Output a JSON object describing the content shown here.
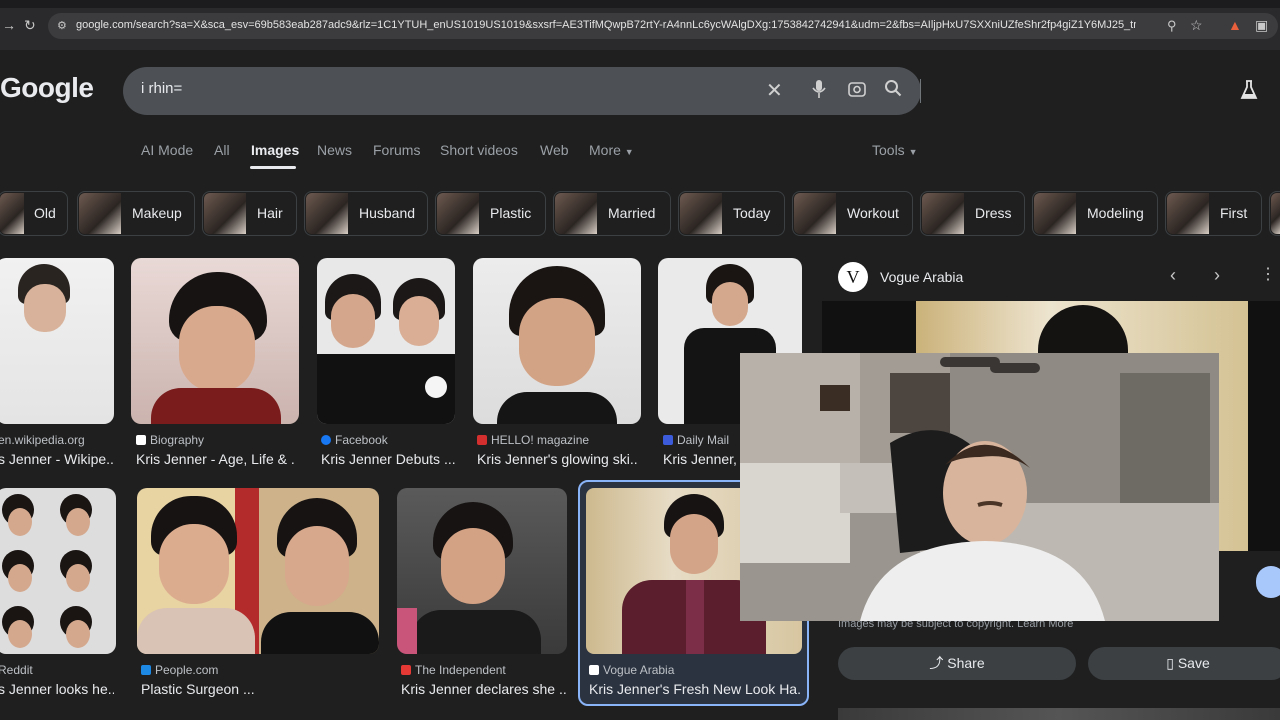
{
  "browser": {
    "url": "google.com/search?sa=X&sca_esv=69b583eab287adc9&rlz=1C1YTUH_enUS1019US1019&sxsrf=AE3TifMQwpB72rtY-rA4nnLc6ycWAlgDXg:1753842742941&udm=2&fbs=AIljpHxU7SXXniUZfeShr2fp4giZ1Y6MJ25_tmWITc7uy4Klei8e83z..."
  },
  "google": {
    "logo": "Google",
    "query": "i rhin="
  },
  "nav": {
    "tabs": [
      "AI Mode",
      "All",
      "Images",
      "News",
      "Forums",
      "Short videos",
      "Web",
      "More"
    ],
    "tools": "Tools"
  },
  "chips": [
    "Old",
    "Makeup",
    "Hair",
    "Husband",
    "Plastic",
    "Married",
    "Today",
    "Workout",
    "Dress",
    "Modeling",
    "First"
  ],
  "results": [
    {
      "source": "en.wikipedia.org",
      "title": "s Jenner - Wikipe..."
    },
    {
      "source": "Biography",
      "title": "Kris Jenner - Age, Life & ..."
    },
    {
      "source": "Facebook",
      "title": "Kris Jenner Debuts ..."
    },
    {
      "source": "HELLO! magazine",
      "title": "Kris Jenner's glowing ski..."
    },
    {
      "source": "Daily Mail",
      "title": "Kris Jenner, 6"
    },
    {
      "source": "Reddit",
      "title": "s Jenner looks he..."
    },
    {
      "source": "People.com",
      "title": "Plastic Surgeon ..."
    },
    {
      "source": "The Independent",
      "title": "Kris Jenner declares she ..."
    },
    {
      "source": "Vogue Arabia",
      "title": "Kris Jenner's Fresh New Look Ha..."
    }
  ],
  "panel": {
    "logo_letter": "V",
    "source": "Vogue Arabia",
    "copyright": "Images may be subject to copyright. Learn More",
    "share": "Share",
    "save": "Save"
  },
  "colors": {
    "background": "#1f1f1f",
    "searchbox": "#4d5156",
    "selected_border": "#8ab4f8"
  }
}
